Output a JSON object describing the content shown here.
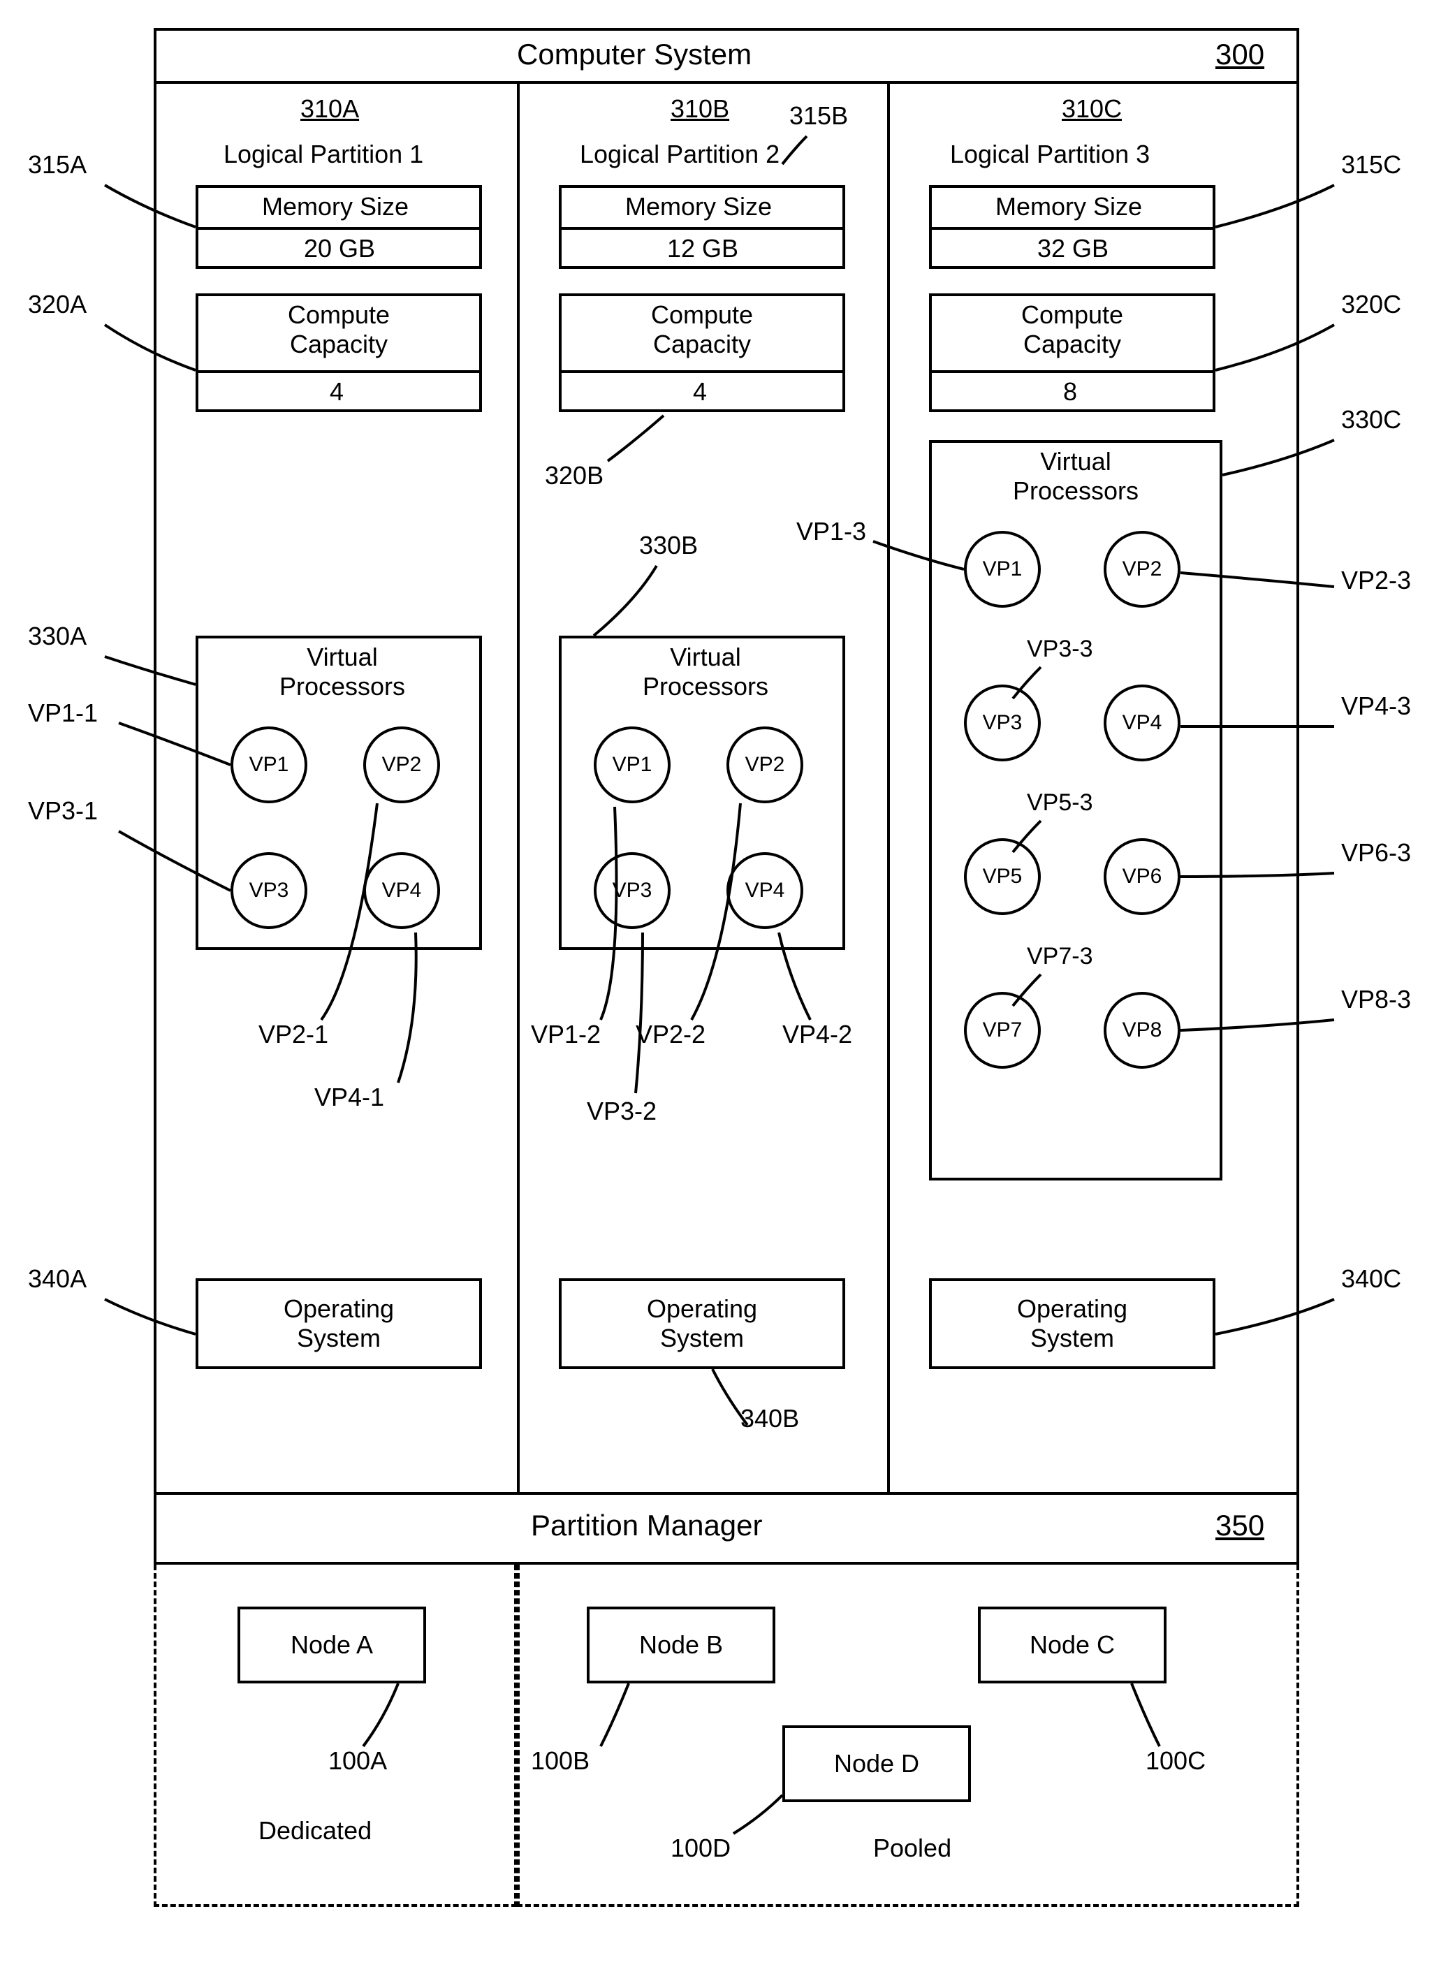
{
  "title": "Computer System",
  "title_ref": "300",
  "partitions": [
    {
      "ref": "310A",
      "name": "Logical Partition 1",
      "memory_label": "Memory Size",
      "memory_value": "20 GB",
      "compute_label": "Compute Capacity",
      "compute_value": "4",
      "vp_label": "Virtual Processors",
      "vps": [
        "VP1",
        "VP2",
        "VP3",
        "VP4"
      ],
      "os_label": "Operating System"
    },
    {
      "ref": "310B",
      "name": "Logical Partition 2",
      "memory_label": "Memory Size",
      "memory_value": "12 GB",
      "compute_label": "Compute Capacity",
      "compute_value": "4",
      "vp_label": "Virtual Processors",
      "vps": [
        "VP1",
        "VP2",
        "VP3",
        "VP4"
      ],
      "os_label": "Operating System"
    },
    {
      "ref": "310C",
      "name": "Logical Partition 3",
      "memory_label": "Memory Size",
      "memory_value": "32 GB",
      "compute_label": "Compute Capacity",
      "compute_value": "8",
      "vp_label": "Virtual Processors",
      "vps": [
        "VP1",
        "VP2",
        "VP3",
        "VP4",
        "VP5",
        "VP6",
        "VP7",
        "VP8"
      ],
      "os_label": "Operating System"
    }
  ],
  "partition_manager": {
    "label": "Partition Manager",
    "ref": "350"
  },
  "nodes": {
    "a": "Node A",
    "b": "Node B",
    "c": "Node C",
    "d": "Node D",
    "dedicated_label": "Dedicated",
    "pooled_label": "Pooled"
  },
  "callouts": {
    "c315A": "315A",
    "c315B": "315B",
    "c315C": "315C",
    "c320A": "320A",
    "c320B": "320B",
    "c320C": "320C",
    "c330A": "330A",
    "c330B": "330B",
    "c330C": "330C",
    "c340A": "340A",
    "c340B": "340B",
    "c340C": "340C",
    "vp11": "VP1-1",
    "vp21": "VP2-1",
    "vp31": "VP3-1",
    "vp41": "VP4-1",
    "vp12": "VP1-2",
    "vp22": "VP2-2",
    "vp32": "VP3-2",
    "vp42": "VP4-2",
    "vp13": "VP1-3",
    "vp23": "VP2-3",
    "vp33": "VP3-3",
    "vp43": "VP4-3",
    "vp53": "VP5-3",
    "vp63": "VP6-3",
    "vp73": "VP7-3",
    "vp83": "VP8-3",
    "n100A": "100A",
    "n100B": "100B",
    "n100C": "100C",
    "n100D": "100D"
  }
}
